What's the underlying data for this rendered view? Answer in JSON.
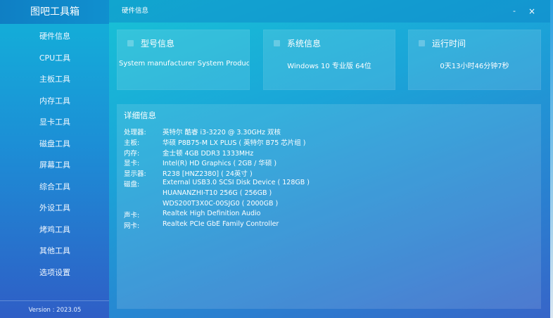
{
  "app": {
    "title": "图吧工具箱",
    "version": "Version : 2023.05"
  },
  "sidebar": {
    "items": [
      {
        "label": "硬件信息"
      },
      {
        "label": "CPU工具"
      },
      {
        "label": "主板工具"
      },
      {
        "label": "内存工具"
      },
      {
        "label": "显卡工具"
      },
      {
        "label": "磁盘工具"
      },
      {
        "label": "屏幕工具"
      },
      {
        "label": "综合工具"
      },
      {
        "label": "外设工具"
      },
      {
        "label": "烤鸡工具"
      },
      {
        "label": "其他工具"
      },
      {
        "label": "选项设置"
      }
    ]
  },
  "window": {
    "title": "硬件信息",
    "minimize_label": "-",
    "close_label": "×"
  },
  "cards": {
    "model": {
      "title": "型号信息",
      "value": "System manufacturer System Product N"
    },
    "system": {
      "title": "系统信息",
      "value": "Windows 10 专业版 64位"
    },
    "uptime": {
      "title": "运行时间",
      "value": "0天13小时46分钟7秒"
    }
  },
  "detail": {
    "title": "详细信息",
    "rows": [
      {
        "key": "处理器:",
        "value": "英特尔 酷睿 i3-3220 @ 3.30GHz 双核"
      },
      {
        "key": "主板:",
        "value": "华硕 P8B75-M LX PLUS ( 英特尔 B75 芯片组 )"
      },
      {
        "key": "内存:",
        "value": "金士顿 4GB DDR3 1333MHz"
      },
      {
        "key": "显卡:",
        "value": "Intel(R) HD Graphics ( 2GB / 华硕 )"
      },
      {
        "key": "显示器:",
        "value": "R238 [HNZ2380] ( 24英寸 )"
      },
      {
        "key": "磁盘:",
        "value": "External USB3.0 SCSI Disk Device ( 128GB )"
      },
      {
        "key": "",
        "value": "HUANANZHI-T10 256G ( 256GB )"
      },
      {
        "key": "",
        "value": "WDS200T3X0C-00SJG0 ( 2000GB )"
      },
      {
        "key": "声卡:",
        "value": "Realtek High Definition Audio"
      },
      {
        "key": "网卡:",
        "value": "Realtek PCIe GbE Family Controller"
      }
    ]
  },
  "colors": {
    "sidebar_top": "#12b3d9",
    "sidebar_bottom": "#2f5ec6",
    "main_top": "#17c2d6",
    "main_bottom": "#3765c8"
  }
}
